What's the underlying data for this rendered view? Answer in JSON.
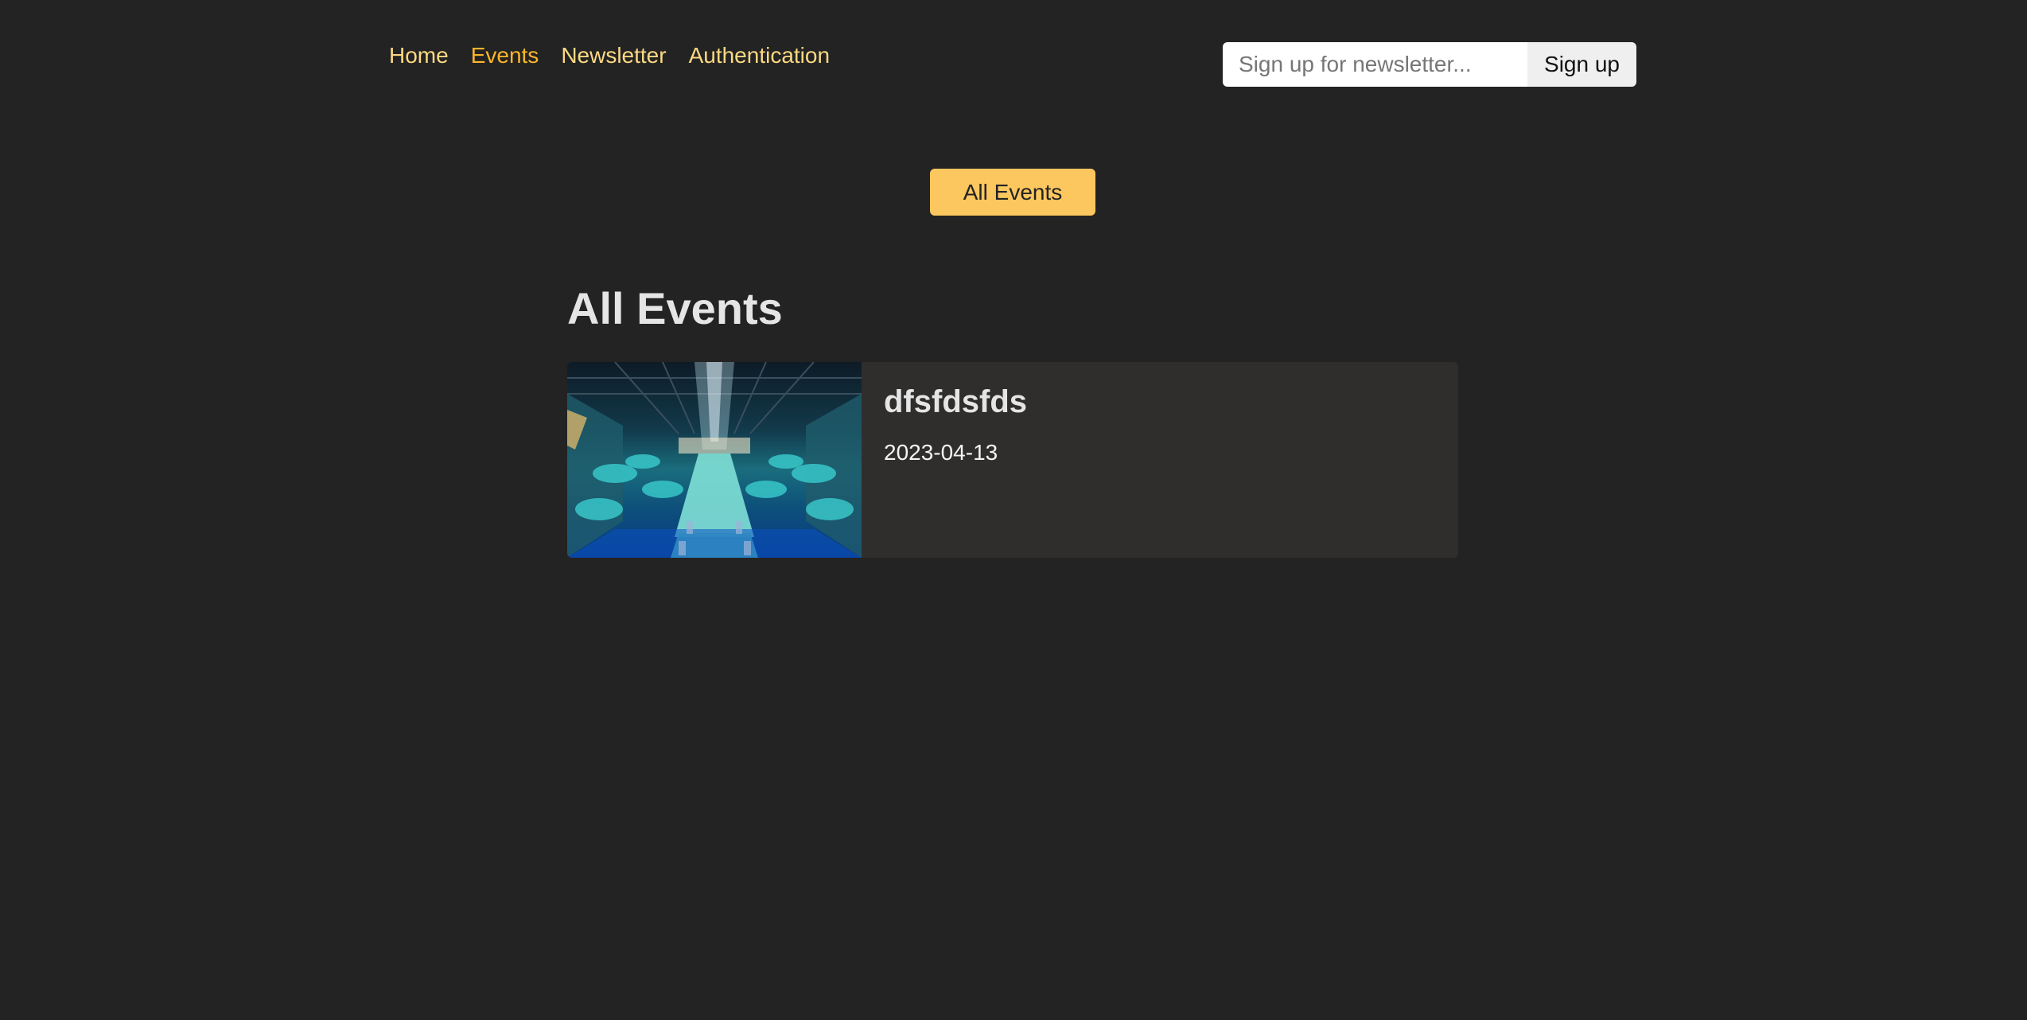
{
  "nav": {
    "items": [
      {
        "label": "Home",
        "active": false
      },
      {
        "label": "Events",
        "active": true
      },
      {
        "label": "Newsletter",
        "active": false
      },
      {
        "label": "Authentication",
        "active": false
      }
    ]
  },
  "newsletter": {
    "placeholder": "Sign up for newsletter...",
    "value": "",
    "button_label": "Sign up"
  },
  "subnav": {
    "all_events_label": "All Events"
  },
  "main": {
    "title": "All Events",
    "events": [
      {
        "title": "dfsfdsfds",
        "date": "2023-04-13",
        "image_icon": "event-venue-photo"
      }
    ]
  },
  "colors": {
    "background": "#232323",
    "accent": "#fcc75e",
    "nav_link": "#fcd982",
    "nav_active": "#fcb62a",
    "card_background": "#2f2e2c"
  }
}
